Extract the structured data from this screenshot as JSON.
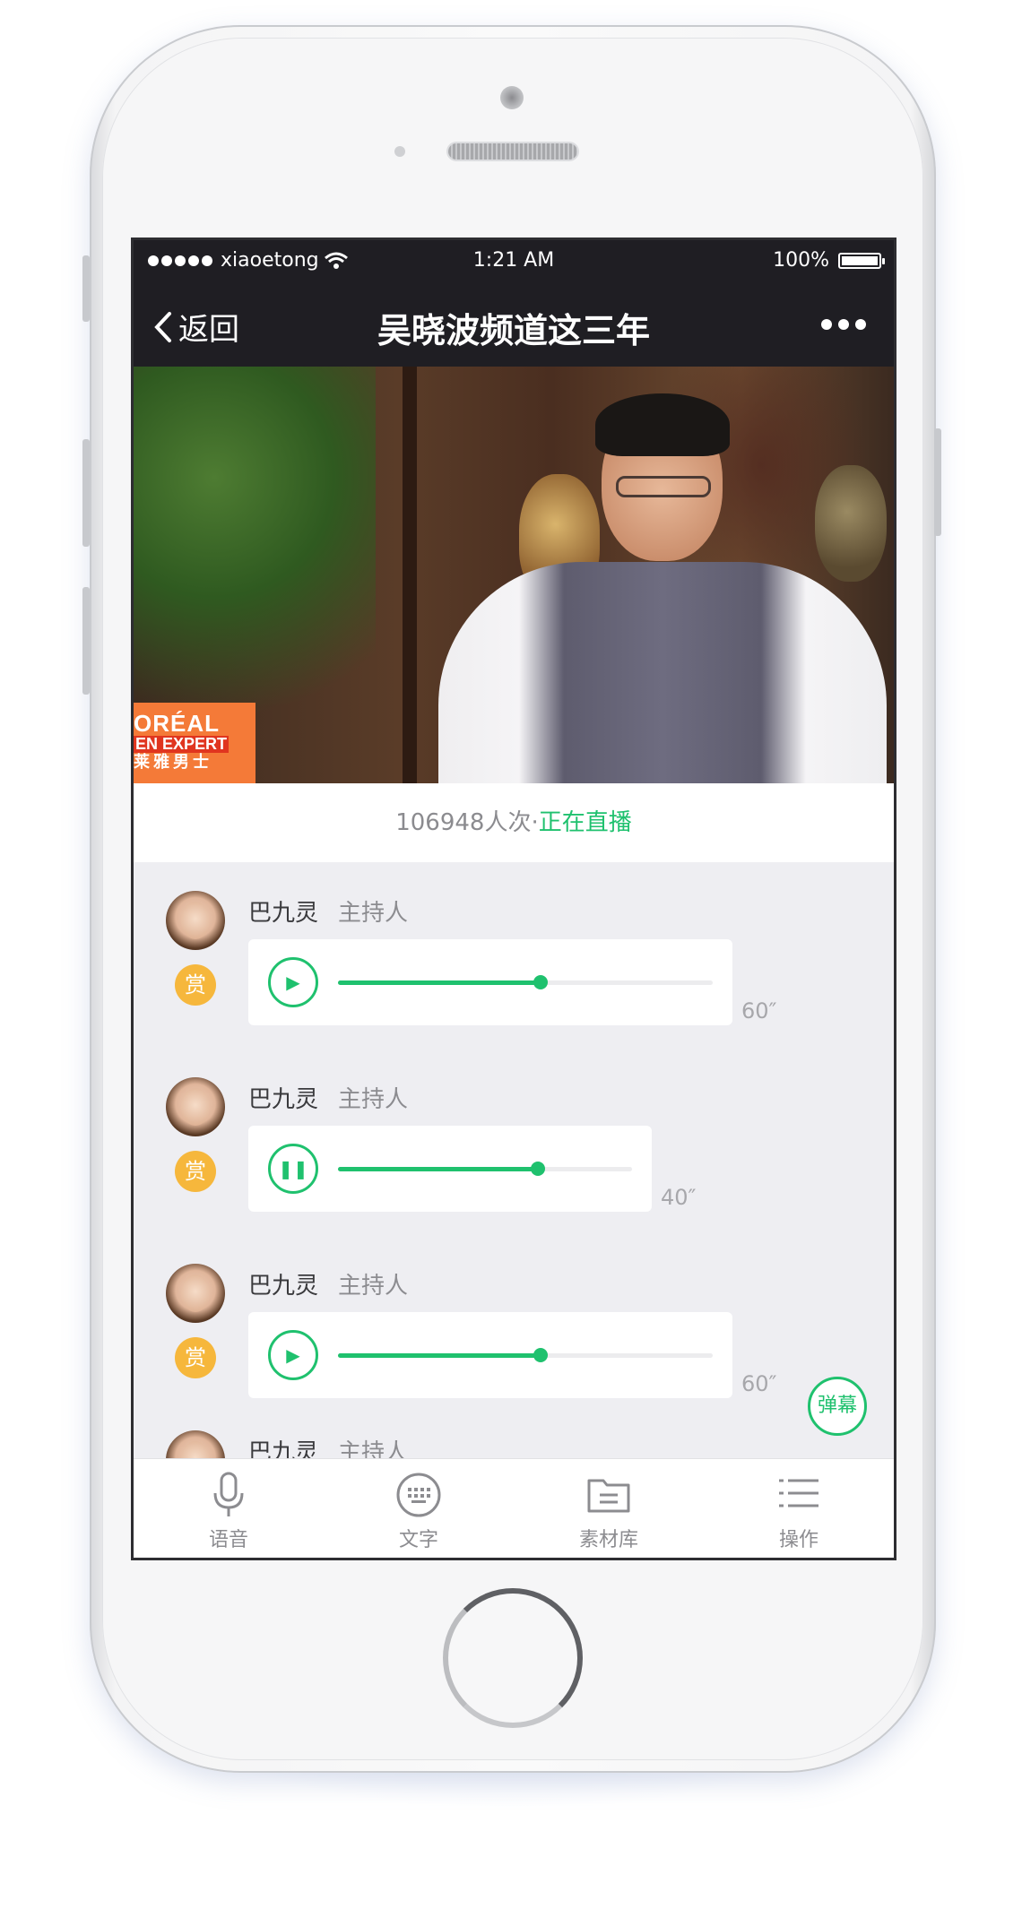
{
  "status_bar": {
    "carrier": "xiaoetong",
    "time": "1:21 AM",
    "battery": "100%"
  },
  "nav": {
    "back_label": "返回",
    "title": "吴晓波频道这三年",
    "more_icon": "more-dots-icon"
  },
  "video": {
    "ad_line1": "ORÉAL",
    "ad_line2": "EN EXPERT",
    "ad_line3": "莱雅男士"
  },
  "stats": {
    "views": "106948人次",
    "separator": "·",
    "live_status": "正在直播"
  },
  "messages": [
    {
      "name": "巴九灵",
      "role": "主持人",
      "reward": "赏",
      "duration": "60″",
      "state": "play",
      "progress": 0.54
    },
    {
      "name": "巴九灵",
      "role": "主持人",
      "reward": "赏",
      "duration": "40″",
      "state": "pause",
      "progress": 0.68
    },
    {
      "name": "巴九灵",
      "role": "主持人",
      "reward": "赏",
      "duration": "60″",
      "state": "play",
      "progress": 0.54
    },
    {
      "name": "巴九灵",
      "role": "主持人"
    }
  ],
  "danmaku_label": "弹幕",
  "tabs": [
    {
      "label": "语音",
      "icon": "microphone-icon"
    },
    {
      "label": "文字",
      "icon": "keyboard-icon"
    },
    {
      "label": "素材库",
      "icon": "folder-icon"
    },
    {
      "label": "操作",
      "icon": "list-icon"
    }
  ],
  "colors": {
    "accent": "#1fc16e",
    "reward": "#f6b73c",
    "nav_bg": "#1f1e23"
  }
}
